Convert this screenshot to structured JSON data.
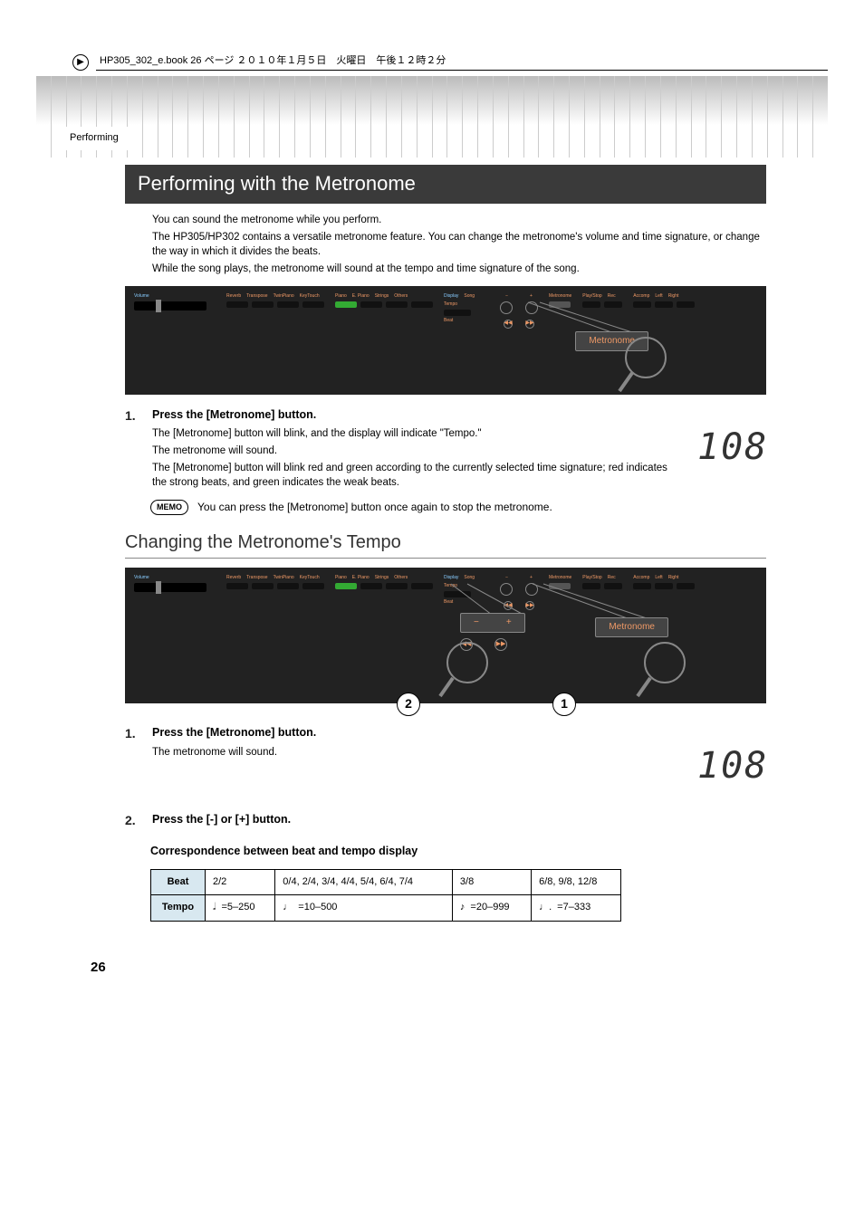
{
  "header": {
    "file_info": "HP305_302_e.book 26 ページ ２０１０年１月５日　火曜日　午後１２時２分",
    "section_tab": "Performing"
  },
  "section": {
    "title": "Performing with the Metronome",
    "intro": [
      "You can sound the metronome while you perform.",
      "The HP305/HP302 contains a versatile metronome feature. You can change the metronome's volume and time signature, or change the way in which it divides the beats.",
      "While the song plays, the metronome will sound at the tempo and time signature of the song."
    ]
  },
  "panel1": {
    "labels": {
      "volume": "Volume",
      "reverb": "Reverb",
      "transpose": "Transpose",
      "twinpiano": "TwinPiano",
      "keytouch": "KeyTouch",
      "piano": "Piano",
      "epiano": "E. Piano",
      "strings": "Strings",
      "others": "Others",
      "display": "Display",
      "song": "Song",
      "tempo": "Tempo",
      "beat": "Beat",
      "metronome": "Metronome",
      "playstop": "Play/Stop",
      "rec": "Rec",
      "accomp": "Accomp",
      "left": "Left",
      "right": "Right"
    },
    "callout": "Metronome"
  },
  "step1": {
    "num": "1.",
    "title": "Press the [Metronome] button.",
    "p1": "The [Metronome] button will blink, and the display will indicate \"Tempo.\"",
    "p2": "The metronome will sound.",
    "p3": "The [Metronome] button will blink red and green according to the currently selected time signature; red indicates the strong beats, and green indicates the weak beats.",
    "memo_label": "MEMO",
    "memo": "You can press the [Metronome] button once again to stop the metronome."
  },
  "subsection": {
    "title": "Changing the Metronome's Tempo"
  },
  "panel2": {
    "callout_metronome": "Metronome",
    "circle1": "1",
    "circle2": "2"
  },
  "step_b1": {
    "num": "1.",
    "title": "Press the [Metronome] button.",
    "p1": "The metronome will sound."
  },
  "step_b2": {
    "num": "2.",
    "title": "Press the [-] or [+] button."
  },
  "table": {
    "title": "Correspondence between beat and tempo display",
    "row_beat_label": "Beat",
    "row_tempo_label": "Tempo",
    "beat": [
      "2/2",
      "0/4, 2/4, 3/4, 4/4, 5/4, 6/4, 7/4",
      "3/8",
      "6/8, 9/8, 12/8"
    ],
    "tempo": [
      "=5–250",
      "=10–500",
      "=20–999",
      "=7–333"
    ]
  },
  "page_number": "26"
}
